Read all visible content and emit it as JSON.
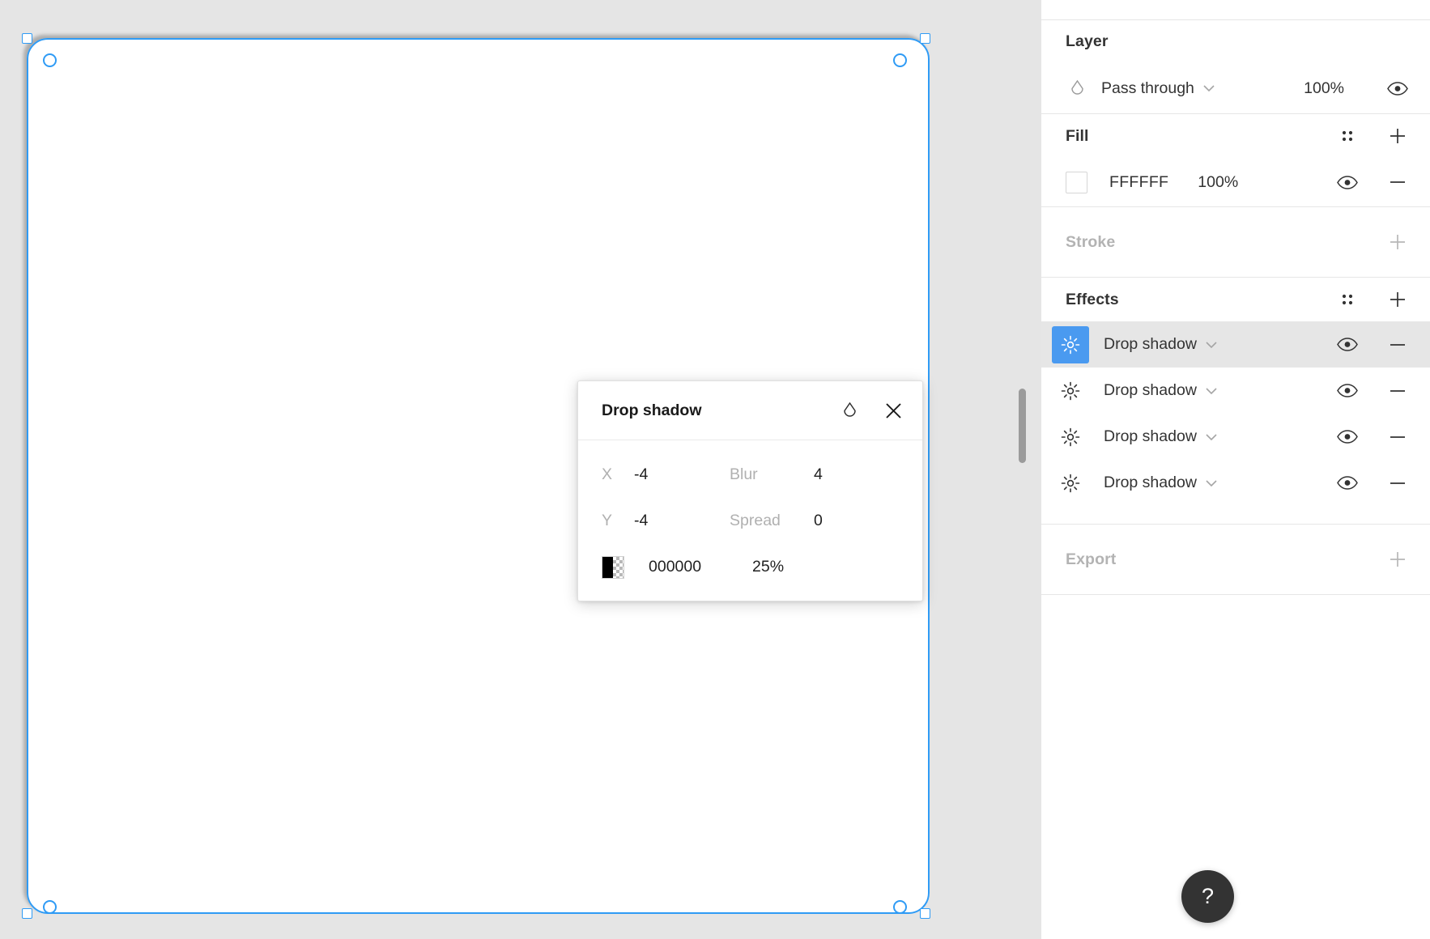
{
  "panel": {
    "layer": {
      "title": "Layer",
      "blend_icon": "droplet-icon",
      "blend_mode": "Pass through",
      "opacity": "100%",
      "visibility_icon": "eye-icon"
    },
    "fill": {
      "title": "Fill",
      "style_icon": "four-dot-grid-icon",
      "add_icon": "plus-icon",
      "items": [
        {
          "swatch": "FFFFFF",
          "hex": "FFFFFF",
          "opacity": "100%",
          "visibility_icon": "eye-icon",
          "remove_icon": "minus-icon"
        }
      ]
    },
    "stroke": {
      "title": "Stroke",
      "add_icon": "plus-icon"
    },
    "effects": {
      "title": "Effects",
      "style_icon": "four-dot-grid-icon",
      "add_icon": "plus-icon",
      "items": [
        {
          "icon": "effect-sun-icon",
          "label": "Drop shadow",
          "selected": true,
          "visibility_icon": "eye-icon",
          "remove_icon": "minus-icon"
        },
        {
          "icon": "effect-sun-icon",
          "label": "Drop shadow",
          "selected": false,
          "visibility_icon": "eye-icon",
          "remove_icon": "minus-icon"
        },
        {
          "icon": "effect-sun-icon",
          "label": "Drop shadow",
          "selected": false,
          "visibility_icon": "eye-icon",
          "remove_icon": "minus-icon"
        },
        {
          "icon": "effect-sun-icon",
          "label": "Drop shadow",
          "selected": false,
          "visibility_icon": "eye-icon",
          "remove_icon": "minus-icon"
        }
      ]
    },
    "export": {
      "title": "Export",
      "add_icon": "plus-icon"
    }
  },
  "popup": {
    "title": "Drop shadow",
    "blend_icon": "droplet-icon",
    "close_icon": "close-icon",
    "fields": {
      "x_label": "X",
      "x_value": "-4",
      "y_label": "Y",
      "y_value": "-4",
      "blur_label": "Blur",
      "blur_value": "4",
      "spread_label": "Spread",
      "spread_value": "0"
    },
    "color": {
      "hex": "000000",
      "opacity": "25%",
      "swatch_name": "black-transparent-swatch"
    }
  },
  "canvas": {
    "artboard_fill": "#FFFFFF",
    "background": "#E5E5E5",
    "selection_color": "#2F9BF5"
  },
  "help": {
    "label": "?"
  }
}
